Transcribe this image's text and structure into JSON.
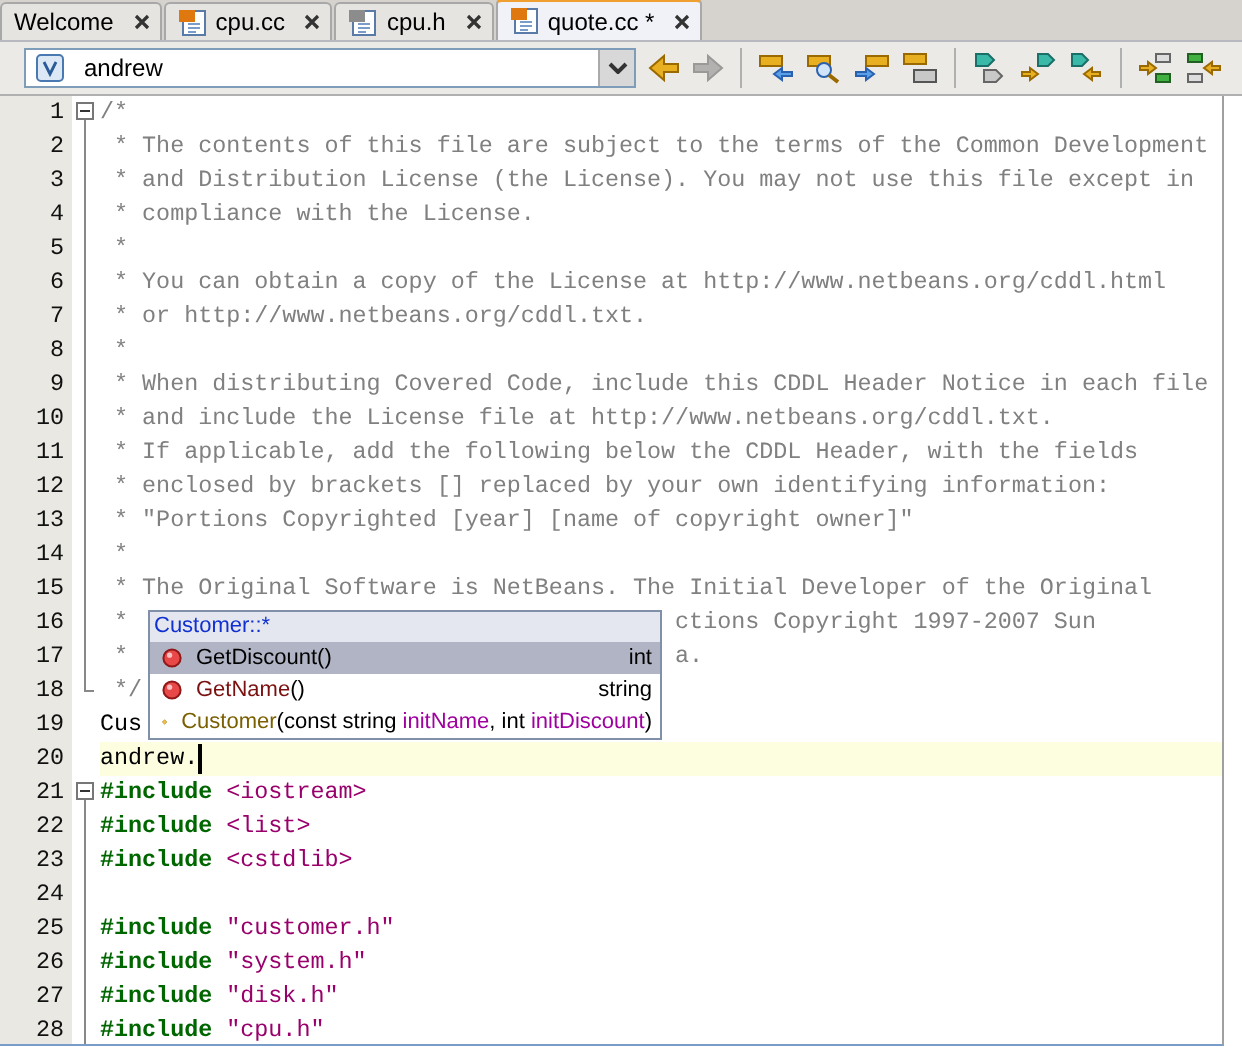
{
  "tabs": [
    {
      "label": "Welcome",
      "kind": "page",
      "selected": false
    },
    {
      "label": "cpu.cc",
      "kind": "source",
      "selected": false
    },
    {
      "label": "cpu.h",
      "kind": "header",
      "selected": false
    },
    {
      "label": "quote.cc *",
      "kind": "source",
      "selected": true
    }
  ],
  "toolbar": {
    "scope_combo": {
      "value": "andrew"
    },
    "buttons": [
      {
        "kind": "back",
        "disabled": false
      },
      {
        "kind": "forward",
        "disabled": true
      },
      {
        "kind": "box-arrow-left",
        "disabled": false
      },
      {
        "kind": "box-magnifier",
        "disabled": false
      },
      {
        "kind": "arrow-box-right",
        "disabled": false
      },
      {
        "kind": "stacked-boxes",
        "disabled": false
      },
      {
        "kind": "tag-arrow",
        "disabled": false
      },
      {
        "kind": "arrow-tag-up",
        "disabled": false
      },
      {
        "kind": "tag-arrow-left",
        "disabled": false
      },
      {
        "kind": "swap-left",
        "disabled": false
      },
      {
        "kind": "swap-right",
        "disabled": false
      }
    ]
  },
  "editor": {
    "lines": [
      {
        "number": "1",
        "expanded": true,
        "current": false,
        "segments": [
          {
            "kind": "comment",
            "text": "/*"
          }
        ]
      },
      {
        "number": "2",
        "current": false,
        "segments": [
          {
            "kind": "comment",
            "text": " * The contents of this file are subject to the terms of the Common Development"
          }
        ]
      },
      {
        "number": "3",
        "current": false,
        "segments": [
          {
            "kind": "comment",
            "text": " * and Distribution License (the License). You may not use this file except in"
          }
        ]
      },
      {
        "number": "4",
        "current": false,
        "segments": [
          {
            "kind": "comment",
            "text": " * compliance with the License."
          }
        ]
      },
      {
        "number": "5",
        "current": false,
        "segments": [
          {
            "kind": "comment",
            "text": " *"
          }
        ]
      },
      {
        "number": "6",
        "current": false,
        "segments": [
          {
            "kind": "comment",
            "text": " * You can obtain a copy of the License at http://www.netbeans.org/cddl.html"
          }
        ]
      },
      {
        "number": "7",
        "current": false,
        "segments": [
          {
            "kind": "comment",
            "text": " * or http://www.netbeans.org/cddl.txt."
          }
        ]
      },
      {
        "number": "8",
        "current": false,
        "segments": [
          {
            "kind": "comment",
            "text": " *"
          }
        ]
      },
      {
        "number": "9",
        "current": false,
        "segments": [
          {
            "kind": "comment",
            "text": " * When distributing Covered Code, include this CDDL Header Notice in each file"
          }
        ]
      },
      {
        "number": "10",
        "current": false,
        "segments": [
          {
            "kind": "comment",
            "text": " * and include the License file at http://www.netbeans.org/cddl.txt."
          }
        ]
      },
      {
        "number": "11",
        "current": false,
        "segments": [
          {
            "kind": "comment",
            "text": " * If applicable, add the following below the CDDL Header, with the fields"
          }
        ]
      },
      {
        "number": "12",
        "current": false,
        "segments": [
          {
            "kind": "comment",
            "text": " * enclosed by brackets [] replaced by your own identifying information:"
          }
        ]
      },
      {
        "number": "13",
        "current": false,
        "segments": [
          {
            "kind": "comment",
            "text": " * \"Portions Copyrighted [year] [name of copyright owner]\""
          }
        ]
      },
      {
        "number": "14",
        "current": false,
        "segments": [
          {
            "kind": "comment",
            "text": " *"
          }
        ]
      },
      {
        "number": "15",
        "current": false,
        "segments": [
          {
            "kind": "comment",
            "text": " * The Original Software is NetBeans. The Initial Developer of the Original"
          }
        ]
      },
      {
        "number": "16",
        "current": false,
        "segments": [
          {
            "kind": "comment",
            "text": " *"
          },
          {
            "kind": "comment-tail",
            "text": "ctions Copyright 1997-2007 Sun"
          }
        ]
      },
      {
        "number": "17",
        "current": false,
        "segments": [
          {
            "kind": "comment",
            "text": " *"
          },
          {
            "kind": "comment-tail",
            "text": "a."
          }
        ]
      },
      {
        "number": "18",
        "fold_end": true,
        "current": false,
        "segments": [
          {
            "kind": "comment",
            "text": " */"
          }
        ]
      },
      {
        "number": "19",
        "current": false,
        "segments": [
          {
            "kind": "plain",
            "text": "Cus"
          }
        ]
      },
      {
        "number": "20",
        "current": true,
        "segments": [
          {
            "kind": "plain",
            "text": "andrew."
          }
        ]
      },
      {
        "number": "21",
        "expanded": true,
        "current": false,
        "segments": [
          {
            "kind": "directive",
            "text": "#include"
          },
          {
            "kind": "string",
            "text": " <iostream>"
          }
        ]
      },
      {
        "number": "22",
        "current": false,
        "segments": [
          {
            "kind": "directive",
            "text": "#include"
          },
          {
            "kind": "string",
            "text": " <list>"
          }
        ]
      },
      {
        "number": "23",
        "current": false,
        "segments": [
          {
            "kind": "directive",
            "text": "#include"
          },
          {
            "kind": "string",
            "text": " <cstdlib>"
          }
        ]
      },
      {
        "number": "24",
        "current": false
      },
      {
        "number": "25",
        "current": false,
        "segments": [
          {
            "kind": "directive",
            "text": "#include"
          },
          {
            "kind": "string",
            "text": " \"customer.h\""
          }
        ]
      },
      {
        "number": "26",
        "current": false,
        "segments": [
          {
            "kind": "directive",
            "text": "#include"
          },
          {
            "kind": "string",
            "text": " \"system.h\""
          }
        ]
      },
      {
        "number": "27",
        "current": false,
        "segments": [
          {
            "kind": "directive",
            "text": "#include"
          },
          {
            "kind": "string",
            "text": " \"disk.h\""
          }
        ]
      },
      {
        "number": "28",
        "current": false,
        "segments": [
          {
            "kind": "directive",
            "text": "#include"
          },
          {
            "kind": "string",
            "text": " \"cpu.h\""
          }
        ]
      }
    ]
  },
  "completion": {
    "title": "Customer::*",
    "items": [
      {
        "kind": "method",
        "selected": true,
        "parts": [
          {
            "kind": "name",
            "text": "GetDiscount"
          },
          {
            "kind": "plain",
            "text": "()"
          }
        ],
        "type": "int"
      },
      {
        "kind": "method",
        "selected": false,
        "parts": [
          {
            "kind": "name",
            "text": "GetName"
          },
          {
            "kind": "plain",
            "text": "()"
          }
        ],
        "type": "string"
      },
      {
        "kind": "constructor",
        "selected": false,
        "parts": [
          {
            "kind": "name",
            "text": "Customer"
          },
          {
            "kind": "plain",
            "text": "(const string "
          },
          {
            "kind": "param",
            "text": "initName"
          },
          {
            "kind": "plain",
            "text": ", int "
          },
          {
            "kind": "param",
            "text": "initDiscount"
          },
          {
            "kind": "plain",
            "text": ")"
          }
        ]
      }
    ]
  }
}
